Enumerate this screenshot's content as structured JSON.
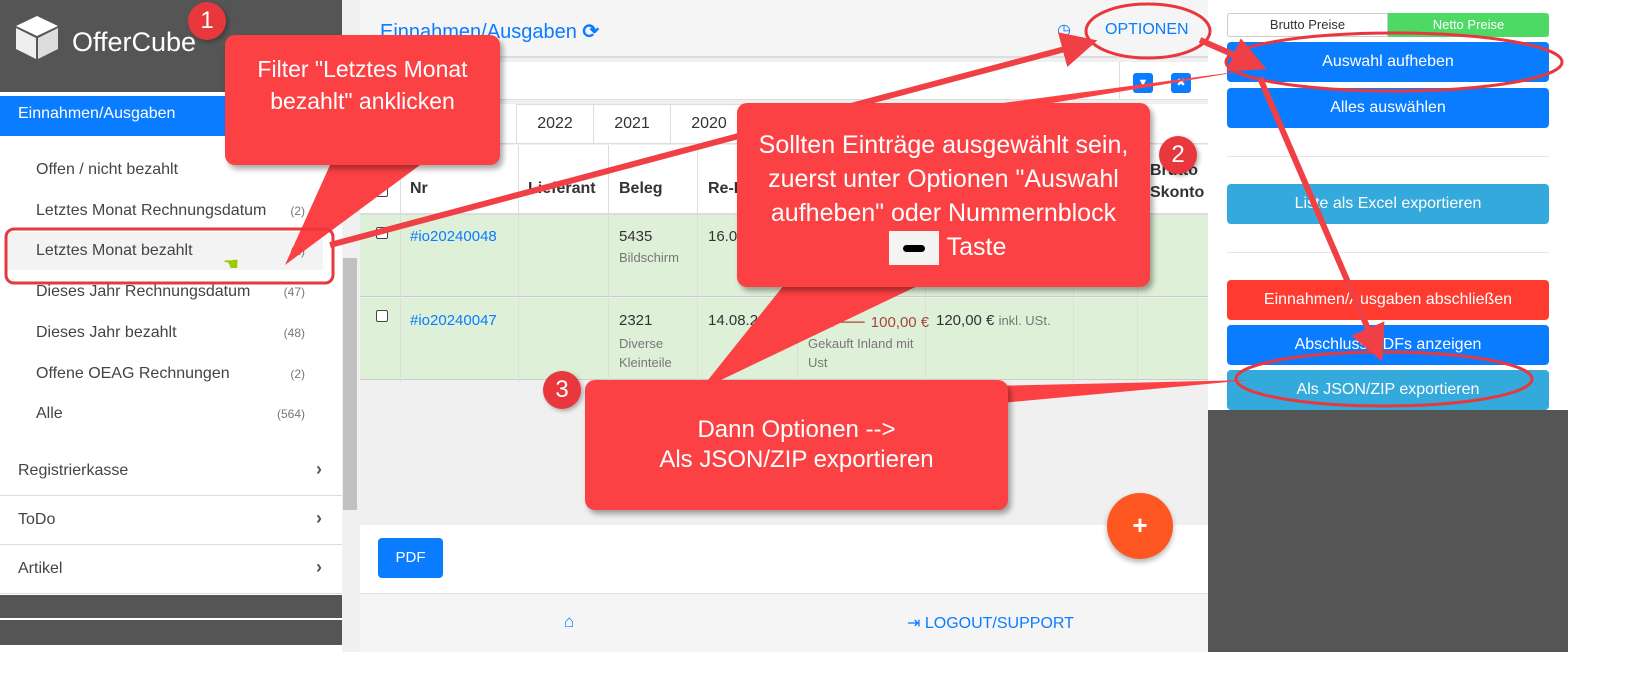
{
  "brand": {
    "name": "OfferCube"
  },
  "sidebar": {
    "active": "Einnahmen/Ausgaben",
    "items": [
      {
        "label": "Offen / nicht bezahlt",
        "count": ""
      },
      {
        "label": "Letztes Monat Rechnungsdatum",
        "count": "(2)"
      },
      {
        "label": "Letztes Monat bezahlt",
        "count": "(2)"
      },
      {
        "label": "Dieses Jahr Rechnungsdatum",
        "count": "(47)"
      },
      {
        "label": "Dieses Jahr bezahlt",
        "count": "(48)"
      },
      {
        "label": "Offene OEAG Rechnungen",
        "count": "(2)"
      },
      {
        "label": "Alle",
        "count": "(564)"
      }
    ],
    "sections": [
      "Registrierkasse",
      "ToDo",
      "Artikel"
    ]
  },
  "main": {
    "title": "Einnahmen/Ausgaben",
    "options": "OPTIONEN",
    "years": [
      "2022",
      "2021",
      "2020"
    ],
    "columns": [
      "Nr",
      "Lieferant",
      "Beleg",
      "Re-D",
      "",
      "",
      "",
      "Brutto Skonto"
    ],
    "rows": [
      {
        "nr": "#io20240048",
        "beleg": "5435",
        "beleg_sub": "Bildschirm",
        "date": "16.08",
        "amount": "",
        "amount_sub": "",
        "brutto": "",
        "brutto_sub": ""
      },
      {
        "nr": "#io20240047",
        "beleg": "2321",
        "beleg_sub": "Diverse Kleinteile",
        "date": "14.08.2024",
        "amount": "100,00 €",
        "amount_sub": "Gekauft Inland mit Ust",
        "brutto": "120,00 €",
        "brutto_sub": "inkl. USt."
      }
    ],
    "pdf": "PDF",
    "fab": "+",
    "logout": "LOGOUT/SUPPORT"
  },
  "right": {
    "brutto": "Brutto Preise",
    "netto": "Netto Preise",
    "deselect": "Auswahl aufheben",
    "select_all": "Alles auswählen",
    "excel": "Liste als Excel exportieren",
    "close": "Einnahmen/Ausgaben abschließen",
    "pdfs": "Abschluss PDFs anzeigen",
    "json": "Als JSON/ZIP exportieren"
  },
  "annotations": {
    "c1": "Filter \"Letztes Monat bezahlt\" anklicken",
    "c2a": "Sollten Einträge ausgewählt sein, zuerst unter Optionen \"Auswahl aufheben\" oder Nummernblock",
    "c2b": "Taste",
    "c3a": "Dann Optionen -->",
    "c3b": "Als JSON/ZIP exportieren",
    "b1": "1",
    "b2": "2",
    "b3": "3"
  },
  "colors": {
    "accent": "#0a7cff",
    "callout": "#fc4144",
    "netto": "#4cd964",
    "danger": "#ff3b30",
    "info": "#34a9db"
  }
}
